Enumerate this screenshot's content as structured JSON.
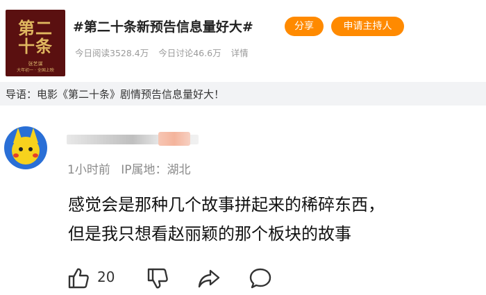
{
  "topic": {
    "poster": {
      "title_line1": "第二",
      "title_line2": "十条",
      "subtitle": "张艺谋",
      "tagline": "大年初一 · 全国上映"
    },
    "title": "#第二十条新预告信息量好大#",
    "share_label": "分享",
    "host_label": "申请主持人",
    "stats": {
      "reads": "今日阅读3528.4万",
      "discussions": "今日讨论46.6万",
      "details": "详情"
    }
  },
  "intro": {
    "text": "导语：电影《第二十条》剧情预告信息量好大！"
  },
  "comment": {
    "time": "1小时前",
    "ip": "IP属地：湖北",
    "content_line1": "感觉会是那种几个故事拼起来的稀碎东西，",
    "content_line2": "但是我只想看赵丽颖的那个板块的故事",
    "like_count": "20",
    "icons": [
      "thumbs-up-icon",
      "thumbs-down-icon",
      "share-arrow-icon",
      "comment-bubble-icon"
    ]
  },
  "colors": {
    "accent": "#ff8a00",
    "intro_bg": "#f2f3f5",
    "poster_bg": "#5a1010"
  }
}
